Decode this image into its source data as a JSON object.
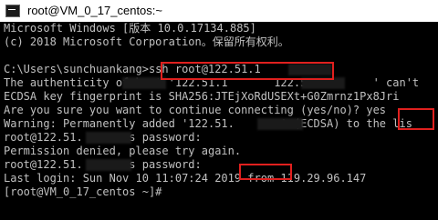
{
  "window": {
    "title": "root@VM_0_17_centos:~"
  },
  "terminal": {
    "line1": "Microsoft Windows [版本 10.0.17134.885]",
    "line2": "(c) 2018 Microsoft Corporation。保留所有权利。",
    "line3": "",
    "line4": "C:\\Users\\sunchuankang>ssh root@122.51.1",
    "line5": "The authenticity of host '122.51.1       122.51.1       ' can't",
    "line6": "ECDSA key fingerprint is SHA256:JTEjXoRdUSEXt+G0Zmrnz1Px8Jri",
    "line7": "Are you sure you want to continue connecting (yes/no)? yes",
    "line8": "Warning: Permanently added '122.51.       ' (ECDSA) to the lis",
    "line9": "root@122.51.       s password:",
    "line10": "Permission denied, please try again.",
    "line11": "root@122.51.       s password:",
    "line12": "Last login: Sun Nov 10 11:07:24 2019 from 119.29.96.147",
    "line13": "[root@VM_0_17_centos ~]#"
  },
  "colors": {
    "terminal_bg": "#000000",
    "terminal_fg": "#c0c0c0",
    "highlight": "#e0201e"
  },
  "icons": {
    "app": "terminal-app-icon"
  }
}
